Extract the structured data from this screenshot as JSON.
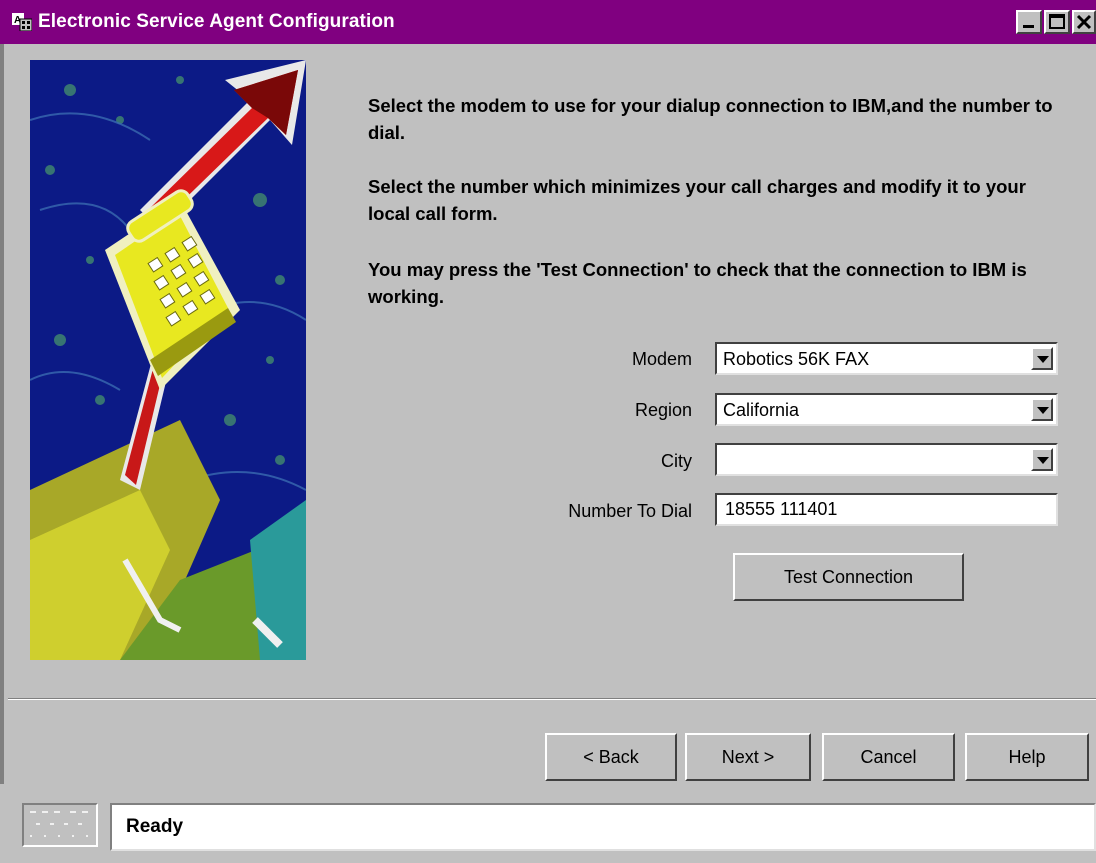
{
  "window": {
    "title": "Electronic Service Agent Configuration",
    "title_bar_color": "#800080"
  },
  "instructions": [
    "Select the modem to use for your dialup connection to IBM,and the number to dial.",
    "Select the number which minimizes your call charges and modify it to your local call form.",
    "You may press the 'Test Connection' to check that the connection to IBM is working."
  ],
  "form": {
    "modem": {
      "label": "Modem",
      "value": "Robotics 56K FAX"
    },
    "region": {
      "label": "Region",
      "value": "California"
    },
    "city": {
      "label": "City",
      "value": ""
    },
    "number": {
      "label": "Number To Dial",
      "value": "18555  111401"
    }
  },
  "test_button": "Test Connection",
  "nav": {
    "back": "< Back",
    "next": "Next >",
    "cancel": "Cancel",
    "help": "Help"
  },
  "status": "Ready",
  "illustration": "telephone-with-arrow"
}
